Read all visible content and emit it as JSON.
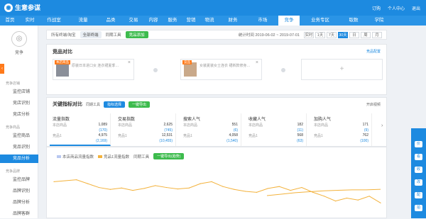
{
  "app": {
    "name": "生意参谋"
  },
  "top_links": [
    "订购",
    "个人中心",
    "退出"
  ],
  "nav": {
    "items": [
      {
        "label": "首页",
        "w": 28
      },
      {
        "label": "实时",
        "w": 28
      },
      {
        "label": "作战室",
        "w": 40
      },
      {
        "label": "流量",
        "w": 42
      },
      {
        "label": "品类",
        "w": 36
      },
      {
        "label": "交易",
        "w": 28
      },
      {
        "label": "内容",
        "w": 28
      },
      {
        "label": "服务",
        "w": 26
      },
      {
        "label": "营销",
        "w": 26
      },
      {
        "label": "物流",
        "w": 26
      },
      {
        "label": "财务",
        "w": 40
      },
      {
        "label": "市场",
        "w": 44
      },
      {
        "label": "竞争",
        "w": 30
      },
      {
        "label": "业务专区",
        "w": 58
      },
      {
        "label": "取数",
        "w": 36
      },
      {
        "label": "学院",
        "w": 36
      }
    ],
    "active": "竞争"
  },
  "sidebar": {
    "logo_label": "竞争",
    "groups": [
      {
        "title": "竞争店铺",
        "items": [
          "监控店铺",
          "竞店识别",
          "竞店分析"
        ]
      },
      {
        "title": "竞争商品",
        "items": [
          "监控商品",
          "竞品识别",
          "竞品分析"
        ]
      },
      {
        "title": "竞争品牌",
        "items": [
          "监控品牌",
          "品牌识别",
          "品牌分析",
          "品牌客群"
        ]
      }
    ],
    "active_item": "竞品分析"
  },
  "filter": {
    "category_label": "所有终端/淘宝",
    "chip": "全部终端",
    "tool_label": "同期工具",
    "save_btn": "竞品添加",
    "date_label": "统计时间 2019-06-02 ~ 2019-07-01",
    "date_buttons": [
      "实时",
      "1天",
      "7天",
      "30天",
      "日",
      "周",
      "月"
    ],
    "active_date": "30天"
  },
  "compare": {
    "title": "竞品对比",
    "link": "竞品配置",
    "products": [
      {
        "tag": "本店商品",
        "text": "原装日本进口女 连衣裙夏季…"
      },
      {
        "tag": "竞品",
        "text": "女装夏装女士连衣 裙新款修身…"
      }
    ],
    "add_symbol": "+"
  },
  "metrics": {
    "title": "关键指标对比",
    "tool_label": "同期工具",
    "btn_primary": "指标选择",
    "btn_secondary": "一键导出",
    "link": "开启视频",
    "columns": [
      {
        "name": "流量指数",
        "own_label": "本店商品",
        "own": "1,089",
        "own_sub": "(170)",
        "comp_label": "竞品1",
        "comp": "4,975",
        "comp_sub": "(2,169)"
      },
      {
        "name": "交易指数",
        "own_label": "本店商品",
        "own": "2,625",
        "own_sub": "(745)",
        "comp_label": "竞品1",
        "comp": "12,531",
        "comp_sub": "(10,455)"
      },
      {
        "name": "搜索人气",
        "own_label": "本店商品",
        "own": "551",
        "own_sub": "(6)",
        "comp_label": "竞品1",
        "comp": "4,058",
        "comp_sub": "(1,540)"
      },
      {
        "name": "收藏人气",
        "own_label": "本店商品",
        "own": "182",
        "own_sub": "(11)",
        "comp_label": "竞品1",
        "comp": "568",
        "comp_sub": "(63)"
      },
      {
        "name": "加购人气",
        "own_label": "本店商品",
        "own": "171",
        "own_sub": "(9)",
        "comp_label": "竞品1",
        "comp": "762",
        "comp_sub": "(100)"
      }
    ]
  },
  "trend": {
    "legend": [
      {
        "label": "本店商品流量指数",
        "color": "#b8c8f0"
      },
      {
        "label": "竞品1流量指数",
        "color": "#f3b23c"
      }
    ],
    "tool_label": "同期工具",
    "btn": "一键导出(趋势)",
    "series": [
      {
        "name": "竞品1流量指数",
        "color": "#f3b23c",
        "values": [
          70,
          72,
          74,
          66,
          58,
          54,
          57,
          52,
          56,
          62,
          58,
          55,
          57,
          66,
          70,
          60,
          54,
          50,
          48,
          56,
          60,
          52,
          58,
          48,
          40,
          30,
          36,
          32,
          40,
          26
        ]
      },
      {
        "name": "本店商品流量指数",
        "color": "#f3b23c",
        "values": [
          0,
          3,
          6,
          8,
          10,
          11,
          12,
          12,
          13
        ]
      }
    ]
  },
  "float_panel": [
    "价",
    "看",
    "收",
    "改",
    "配",
    "拍"
  ],
  "arrow": "›"
}
